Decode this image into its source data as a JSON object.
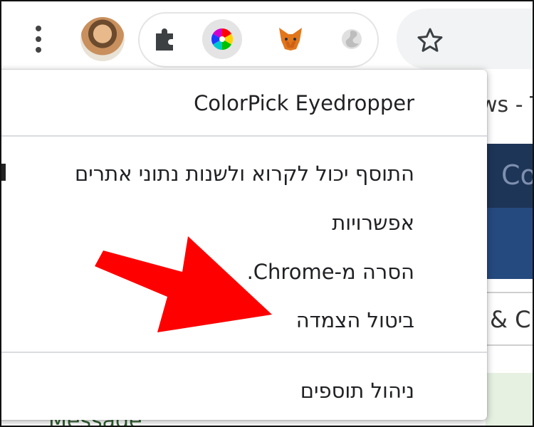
{
  "colors": {
    "arrow": "#ff0000",
    "menu_text": "#202124",
    "separator": "#dadce0",
    "active_extension_bg": "#e4e4e4",
    "page_navy": "#1d3557"
  },
  "toolbar": {
    "icons": [
      "more-vert-icon",
      "avatar",
      "puzzle-icon",
      "colorpick-icon",
      "metamask-fox-icon",
      "gray-extension-icon",
      "star-icon"
    ]
  },
  "background_page": {
    "title_fragment": "ws - T",
    "nav_fragment": "Co",
    "tab_fragment": "& Cl",
    "message_fragment": "Message"
  },
  "menu": {
    "header": "ColorPick Eyedropper",
    "info": "התוסף יכול לקרוא ולשנות נתוני אתרים",
    "options": "אפשרויות",
    "remove": "הסרה מ-Chrome.",
    "unpin": "ביטול הצמדה",
    "manage": "ניהול תוספים"
  }
}
